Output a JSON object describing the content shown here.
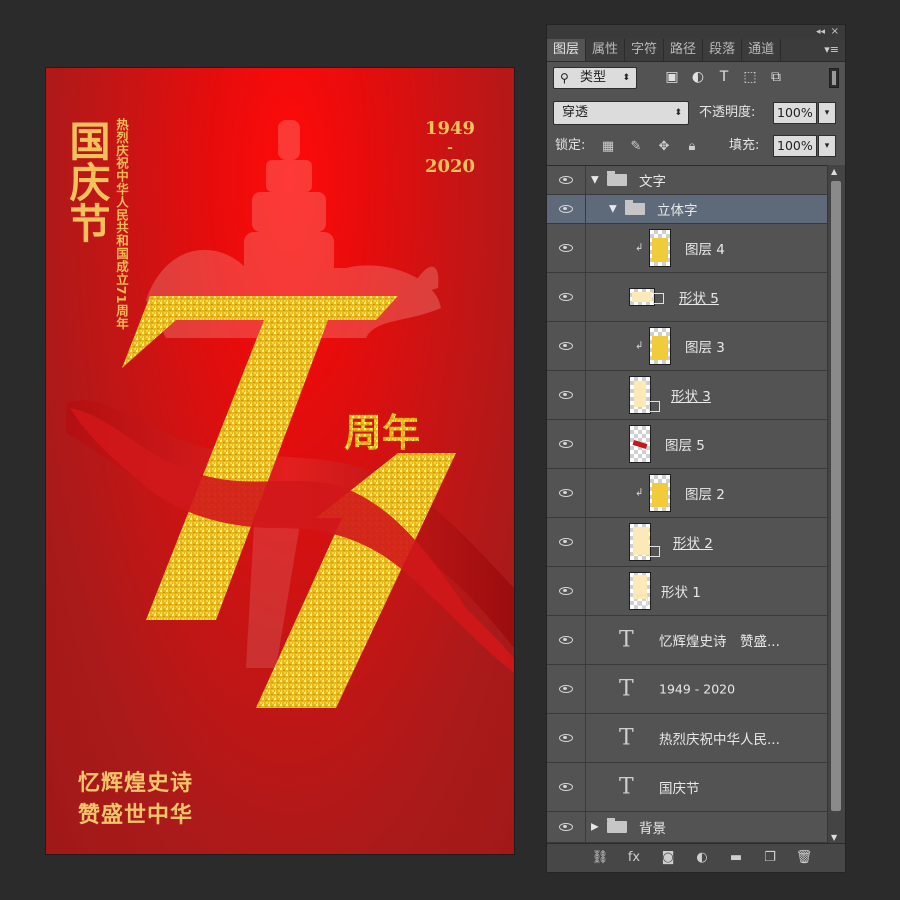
{
  "poster": {
    "title": "国庆节",
    "subtitle": "热烈庆祝中华人民共和国成立71周年",
    "year_start": "1949",
    "year_dash": "-",
    "year_end": "2020",
    "big_number": "71",
    "anniversary": "周年",
    "slogan_line1": "忆辉煌史诗",
    "slogan_line2": "赞盛世中华",
    "colors": {
      "bg_red": "#c81414",
      "gold": "#f2c35d",
      "glitter": "#f0c520"
    }
  },
  "panel": {
    "collapse_icon": "double-chevron-left-icon",
    "close_icon": "close-icon",
    "tabs": [
      {
        "label": "图层"
      },
      {
        "label": "属性"
      },
      {
        "label": "字符"
      },
      {
        "label": "路径"
      },
      {
        "label": "段落"
      },
      {
        "label": "通道"
      }
    ],
    "filter": {
      "label": "类型",
      "icon": "search-icon"
    },
    "blend_mode": "穿透",
    "opacity_label": "不透明度:",
    "opacity_value": "100%",
    "lock_label": "锁定:",
    "fill_label": "填充:",
    "fill_value": "100%",
    "layers": [
      {
        "name": "文字",
        "kind": "group",
        "expanded": true,
        "indent": 0
      },
      {
        "name": "立体字",
        "kind": "group",
        "expanded": true,
        "indent": 1,
        "selected": true
      },
      {
        "name": "图层 4",
        "kind": "pixel",
        "clipped": true
      },
      {
        "name": "形状 5",
        "kind": "shape"
      },
      {
        "name": "图层 3",
        "kind": "pixel",
        "clipped": true
      },
      {
        "name": "形状 3",
        "kind": "shape"
      },
      {
        "name": "图层 5",
        "kind": "pixel"
      },
      {
        "name": "图层 2",
        "kind": "pixel",
        "clipped": true
      },
      {
        "name": "形状 2",
        "kind": "shape"
      },
      {
        "name": "形状 1",
        "kind": "shape"
      },
      {
        "name": "忆辉煌史诗　赞盛...",
        "kind": "text"
      },
      {
        "name": "1949 - 2020",
        "kind": "text"
      },
      {
        "name": "热烈庆祝中华人民...",
        "kind": "text"
      },
      {
        "name": "国庆节",
        "kind": "text"
      },
      {
        "name": "背景",
        "kind": "group",
        "expanded": false
      }
    ]
  }
}
